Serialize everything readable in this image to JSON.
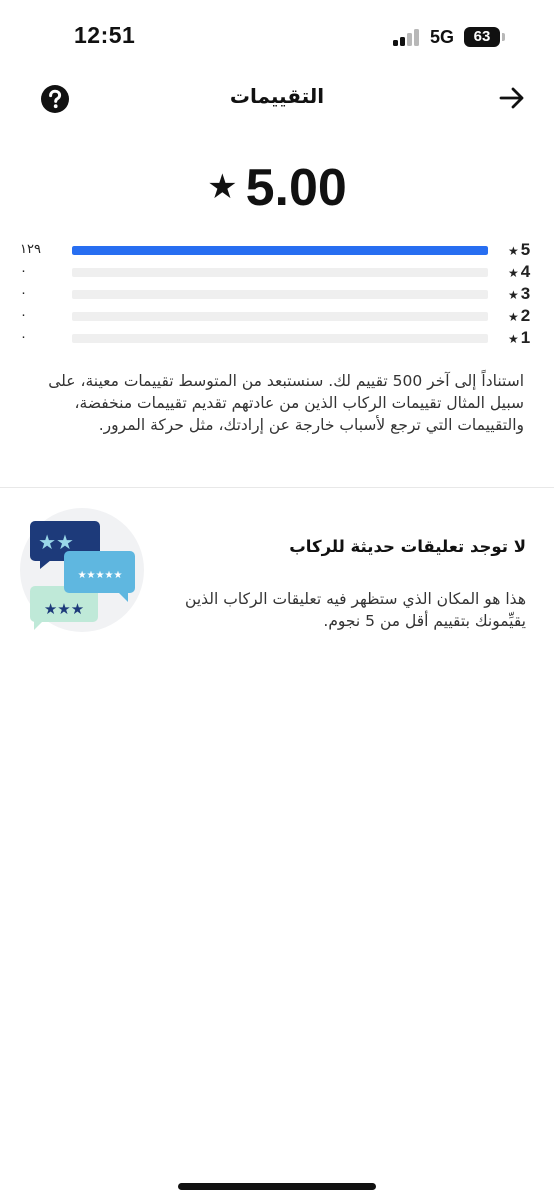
{
  "status_bar": {
    "time": "12:51",
    "network": "5G",
    "battery": "63"
  },
  "header": {
    "title": "التقييمات",
    "help_icon": "question-circle-icon",
    "back_icon": "arrow-right-icon"
  },
  "summary": {
    "average": "5.00",
    "star_glyph": "★"
  },
  "distribution": [
    {
      "stars": "5",
      "count": "١٢٩",
      "fraction": 1.0
    },
    {
      "stars": "4",
      "count": "٠",
      "fraction": 0
    },
    {
      "stars": "3",
      "count": "٠",
      "fraction": 0
    },
    {
      "stars": "2",
      "count": "٠",
      "fraction": 0
    },
    {
      "stars": "1",
      "count": "٠",
      "fraction": 0
    }
  ],
  "explanation": "استناداً إلى آخر 500 تقييم لك. سنستبعد من المتوسط تقييمات معينة، على سبيل المثال تقييمات الركاب الذين من عادتهم تقديم تقييمات منخفضة، والتقييمات التي ترجع لأسباب خارجة عن إرادتك، مثل حركة المرور.",
  "comments": {
    "empty_title": "لا توجد تعليقات حديثة للركاب",
    "empty_description": "هذا هو المكان الذي ستظهر فيه تعليقات الركاب الذين يقيِّمونك بتقييم أقل من 5 نجوم.",
    "illustration_icon": "chat-bubbles-stars-icon"
  },
  "colors": {
    "accent_blue": "#276ef1",
    "track": "#efefef",
    "navy": "#1d3a7a",
    "sky": "#5fb7e0",
    "mint": "#bfe9d8"
  }
}
